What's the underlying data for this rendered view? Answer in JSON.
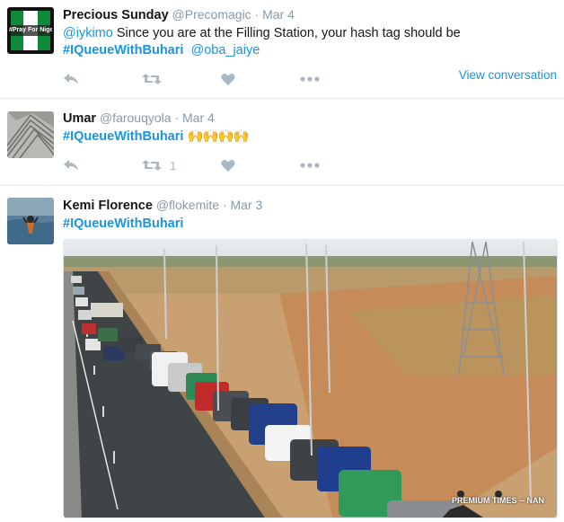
{
  "tweets": [
    {
      "name": "Precious Sunday",
      "handle": "@Precomagic",
      "separator": "·",
      "date": "Mar 4",
      "avatar_text": "#Pray For Nigeria",
      "mention": "@iykimo",
      "text_body": " Since you are at the Filling Station, your hash tag should be",
      "hashtag": "#IQueueWithBuhari",
      "mention2": "@oba_jaiye",
      "view_conversation": "View conversation",
      "retweet_count": "",
      "icons": [
        "reply-icon",
        "retweet-icon",
        "like-icon",
        "more-icon"
      ]
    },
    {
      "name": "Umar",
      "handle": "@farouqyola",
      "separator": "·",
      "date": "Mar 4",
      "hashtag": "#IQueueWithBuhari",
      "emoji": "🙌🙌🙌🙌",
      "retweet_count": "1",
      "icons": [
        "reply-icon",
        "retweet-icon",
        "like-icon",
        "more-icon"
      ]
    },
    {
      "name": "Kemi Florence",
      "handle": "@flokemite",
      "separator": "·",
      "date": "Mar 3",
      "hashtag": "#IQueueWithBuhari",
      "photo_credit": "PREMIUM TIMES -- NAN"
    }
  ],
  "colors": {
    "link": "#1b95e0",
    "muted": "#8899a6",
    "icon": "#aab8c2",
    "divider": "#e6ecf0"
  }
}
